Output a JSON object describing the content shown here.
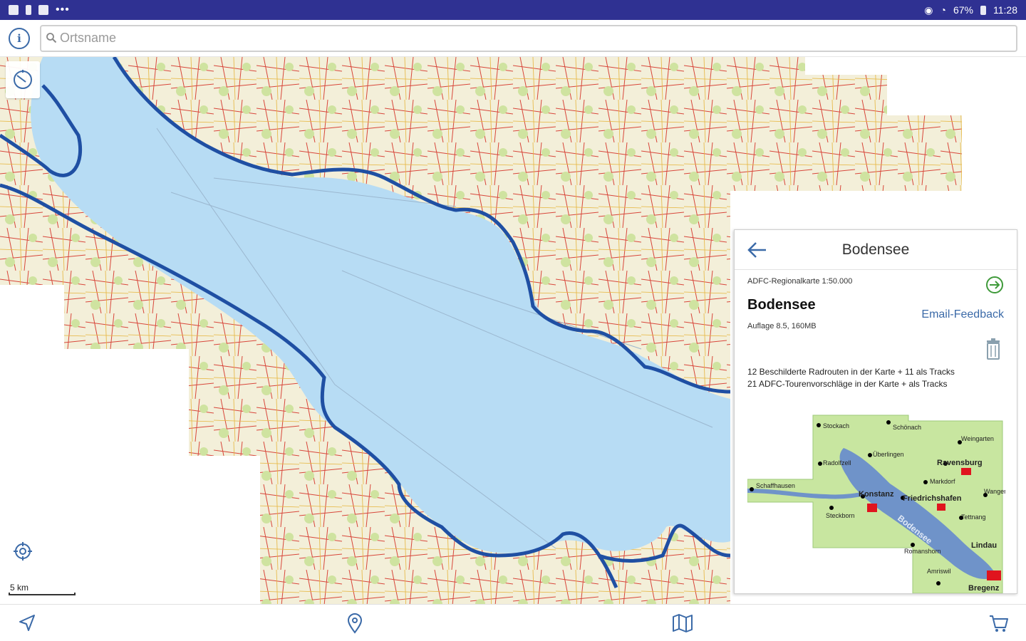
{
  "status_bar": {
    "more": "•••",
    "battery": "67%",
    "time": "11:28"
  },
  "search": {
    "placeholder": "Ortsname"
  },
  "map": {
    "scale_label": "5 km",
    "colors": {
      "lake": "#b7dcf4",
      "route": "#1f4fa3",
      "land": "#f3efd9",
      "forest": "#cfe3a0",
      "road": "#d8463a"
    }
  },
  "panel": {
    "title": "Bodensee",
    "subtitle": "ADFC-Regionalkarte 1:50.000",
    "map_name": "Bodensee",
    "edition": "Auflage 8.5, 160MB",
    "feedback_label": "Email-Feedback",
    "stats_line1": "12 Beschilderte Radrouten in der Karte + 11 als Tracks",
    "stats_line2": "21 ADFC-Tourenvorschläge in der Karte + als Tracks",
    "thumbnail": {
      "places": [
        "Stockach",
        "Schönach",
        "Weingarten",
        "Überlingen",
        "Ravensburg",
        "Radolfzell",
        "Markdorf",
        "Schaffhausen",
        "Konstanz",
        "Friedrichshafen",
        "Wangen",
        "Tettnang",
        "Lindau",
        "Bregenz",
        "Amriswil",
        "Romanshorn",
        "Steckborn",
        "Bodensee"
      ]
    }
  },
  "icons": {
    "info": "info-icon",
    "search": "search-icon",
    "compass": "compass-icon",
    "locate": "locate-icon",
    "back": "arrow-back-icon",
    "open": "arrow-right-circle-icon",
    "trash": "trash-icon",
    "navigate": "navigation-arrow-icon",
    "pin": "map-pin-icon",
    "maps": "map-icon",
    "cart": "cart-icon"
  },
  "info_glyph": "i"
}
